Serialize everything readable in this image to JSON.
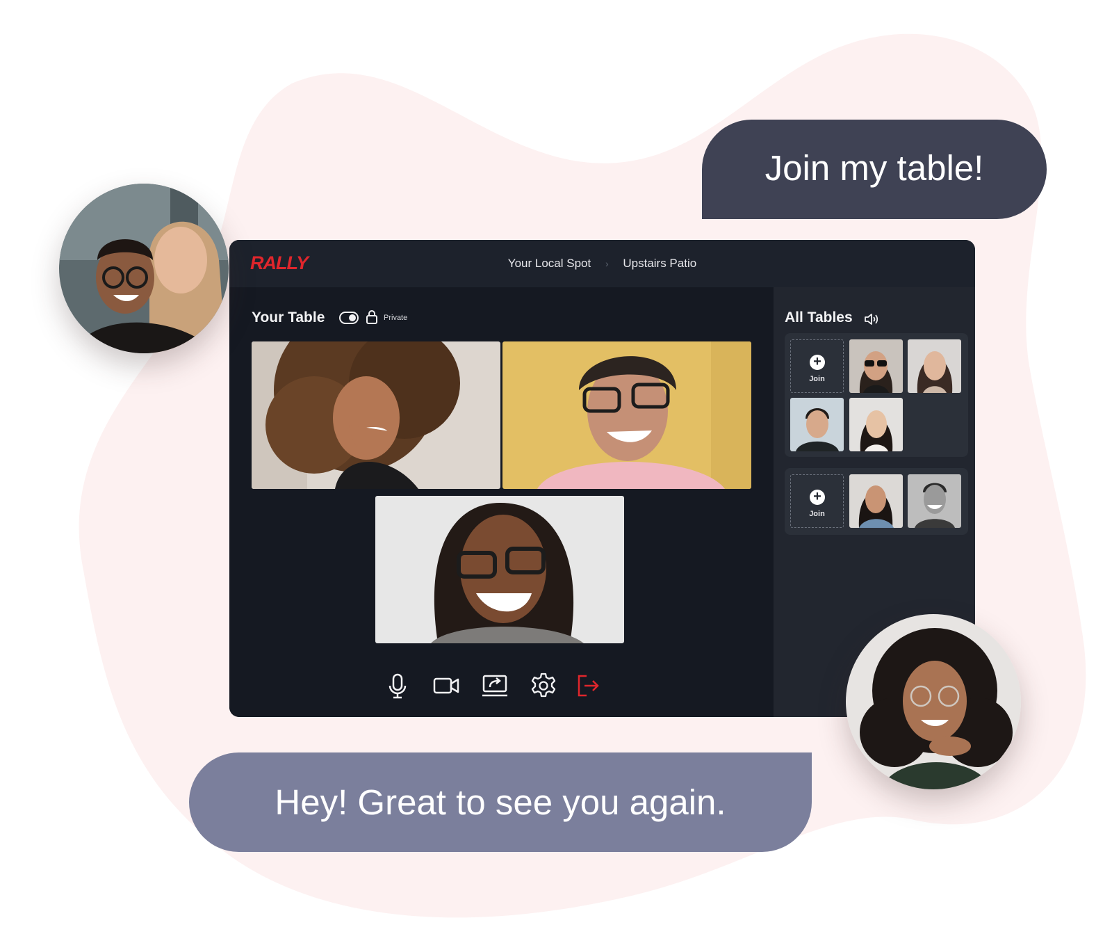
{
  "app": {
    "logo": "RALLY",
    "breadcrumb": [
      "Your Local Spot",
      "Upstairs Patio"
    ],
    "breadcrumb_separator": "›"
  },
  "your_table": {
    "title": "Your Table",
    "privacy_label": "Private",
    "toggle_on": true,
    "participants": [
      {
        "icon": "participant-video-curly-hair-woman"
      },
      {
        "icon": "participant-video-man-glasses"
      },
      {
        "icon": "participant-video-woman-glasses-locs"
      }
    ]
  },
  "controls": [
    {
      "name": "microphone-icon"
    },
    {
      "name": "camera-icon"
    },
    {
      "name": "screen-share-icon"
    },
    {
      "name": "settings-gear-icon"
    },
    {
      "name": "leave-icon"
    }
  ],
  "all_tables": {
    "title": "All Tables",
    "join_label": "Join",
    "tables": [
      {
        "seats": 4
      },
      {
        "seats": 2
      }
    ]
  },
  "chat": {
    "top_message": "Join my table!",
    "bottom_message": "Hey! Great to see you again."
  },
  "colors": {
    "brand": "#e0262c",
    "app_background": "#151922",
    "sidebar_background": "#22262f",
    "bubble_dark": "#3f4254",
    "bubble_light": "#7b7f9c",
    "blob": "#fdf1f1"
  }
}
